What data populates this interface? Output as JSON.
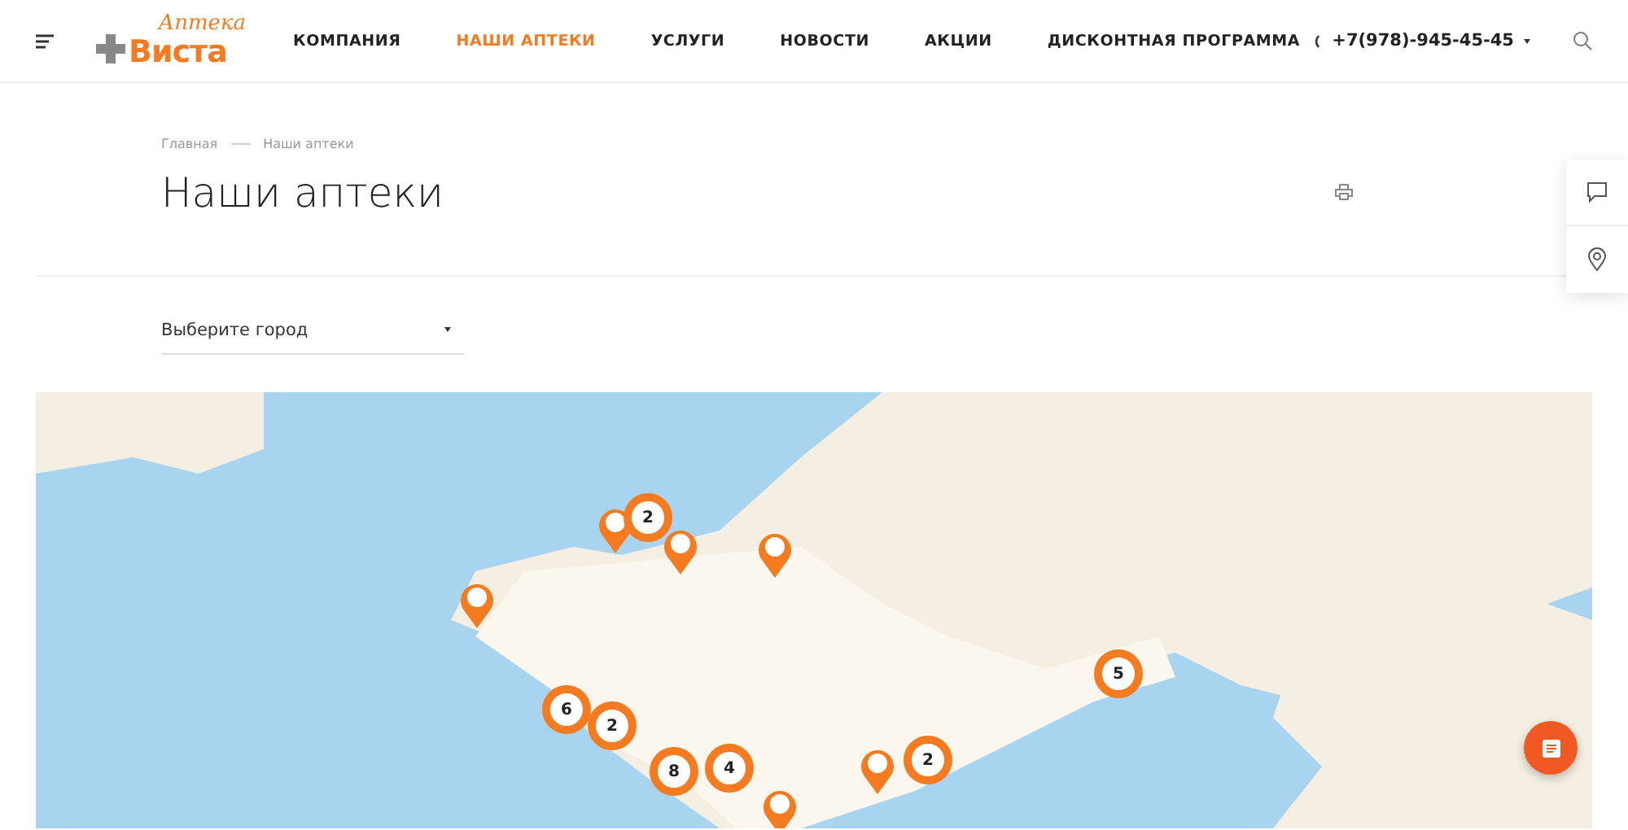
{
  "header": {
    "logo": {
      "script": "Аптека",
      "name": "Виста"
    },
    "nav": [
      {
        "label": "КОМПАНИЯ",
        "selected": false
      },
      {
        "label": "НАШИ АПТЕКИ",
        "selected": true
      },
      {
        "label": "УСЛУГИ",
        "selected": false
      },
      {
        "label": "НОВОСТИ",
        "selected": false
      },
      {
        "label": "АКЦИИ",
        "selected": false
      },
      {
        "label": "ДИСКОНТНАЯ ПРОГРАММА",
        "selected": false
      }
    ],
    "phone": "+7(978)-945-45-45"
  },
  "breadcrumbs": [
    "Главная",
    "Наши аптеки"
  ],
  "title": "Наши аптеки",
  "city_select": {
    "placeholder": "Выберите город"
  },
  "map": {
    "markers": [
      {
        "kind": "pin"
      },
      {
        "kind": "cluster",
        "count": "2"
      },
      {
        "kind": "pin"
      },
      {
        "kind": "pin"
      },
      {
        "kind": "pin"
      },
      {
        "kind": "cluster",
        "count": "6"
      },
      {
        "kind": "cluster",
        "count": "2"
      },
      {
        "kind": "cluster",
        "count": "8"
      },
      {
        "kind": "cluster",
        "count": "4"
      },
      {
        "kind": "cluster",
        "count": "5"
      },
      {
        "kind": "pin"
      },
      {
        "kind": "cluster",
        "count": "2"
      },
      {
        "kind": "pin"
      }
    ]
  }
}
